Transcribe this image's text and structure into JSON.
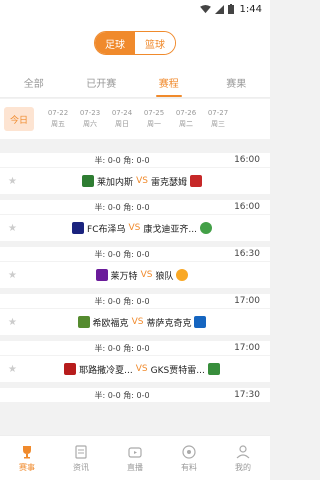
{
  "status": {
    "time": "1:44"
  },
  "sport_toggle": {
    "options": [
      "足球",
      "篮球"
    ],
    "selected": "足球"
  },
  "tabs": [
    "全部",
    "已开赛",
    "赛程",
    "赛果"
  ],
  "active_tab": "赛程",
  "dates": {
    "today_label": "今日",
    "items": [
      {
        "date": "07-22",
        "weekday": "周五"
      },
      {
        "date": "07-23",
        "weekday": "周六"
      },
      {
        "date": "07-24",
        "weekday": "周日"
      },
      {
        "date": "07-25",
        "weekday": "周一"
      },
      {
        "date": "07-26",
        "weekday": "周二"
      },
      {
        "date": "07-27",
        "weekday": "周三"
      }
    ]
  },
  "matches": [
    {
      "half": "半: 0-0  角: 0-0",
      "time": "16:00",
      "home": "莱加内斯",
      "away": "雷克瑟姆",
      "vs": "VS",
      "home_color": "#2e7d32",
      "away_color": "#c62828"
    },
    {
      "half": "半: 0-0  角: 0-0",
      "time": "16:00",
      "home": "FC布泽乌",
      "away": "康戈迪亚齐...",
      "vs": "VS",
      "home_color": "#1a237e",
      "away_color": "#43a047"
    },
    {
      "half": "半: 0-0  角: 0-0",
      "time": "16:30",
      "home": "莱万特",
      "away": "狼队",
      "vs": "VS",
      "home_color": "#6a1b9a",
      "away_color": "#f9a825"
    },
    {
      "half": "半: 0-0  角: 0-0",
      "time": "17:00",
      "home": "希欧福克",
      "away": "蒂萨克奇克",
      "vs": "VS",
      "home_color": "#558b2f",
      "away_color": "#1565c0"
    },
    {
      "half": "半: 0-0  角: 0-0",
      "time": "17:00",
      "home": "耶路撒冷夏...",
      "away": "GKS贾特雷...",
      "vs": "VS",
      "home_color": "#b71c1c",
      "away_color": "#388e3c"
    },
    {
      "half": "半: 0-0  角: 0-0",
      "time": "17:30",
      "home": "",
      "away": "",
      "vs": "",
      "home_color": "#ffffff",
      "away_color": "#ffffff"
    }
  ],
  "bottom_nav": [
    {
      "label": "赛事",
      "icon": "trophy-icon",
      "active": true
    },
    {
      "label": "资讯",
      "icon": "news-icon",
      "active": false
    },
    {
      "label": "直播",
      "icon": "live-icon",
      "active": false
    },
    {
      "label": "有料",
      "icon": "ball-icon",
      "active": false
    },
    {
      "label": "我的",
      "icon": "profile-icon",
      "active": false
    }
  ],
  "colors": {
    "accent": "#f08a2c"
  }
}
